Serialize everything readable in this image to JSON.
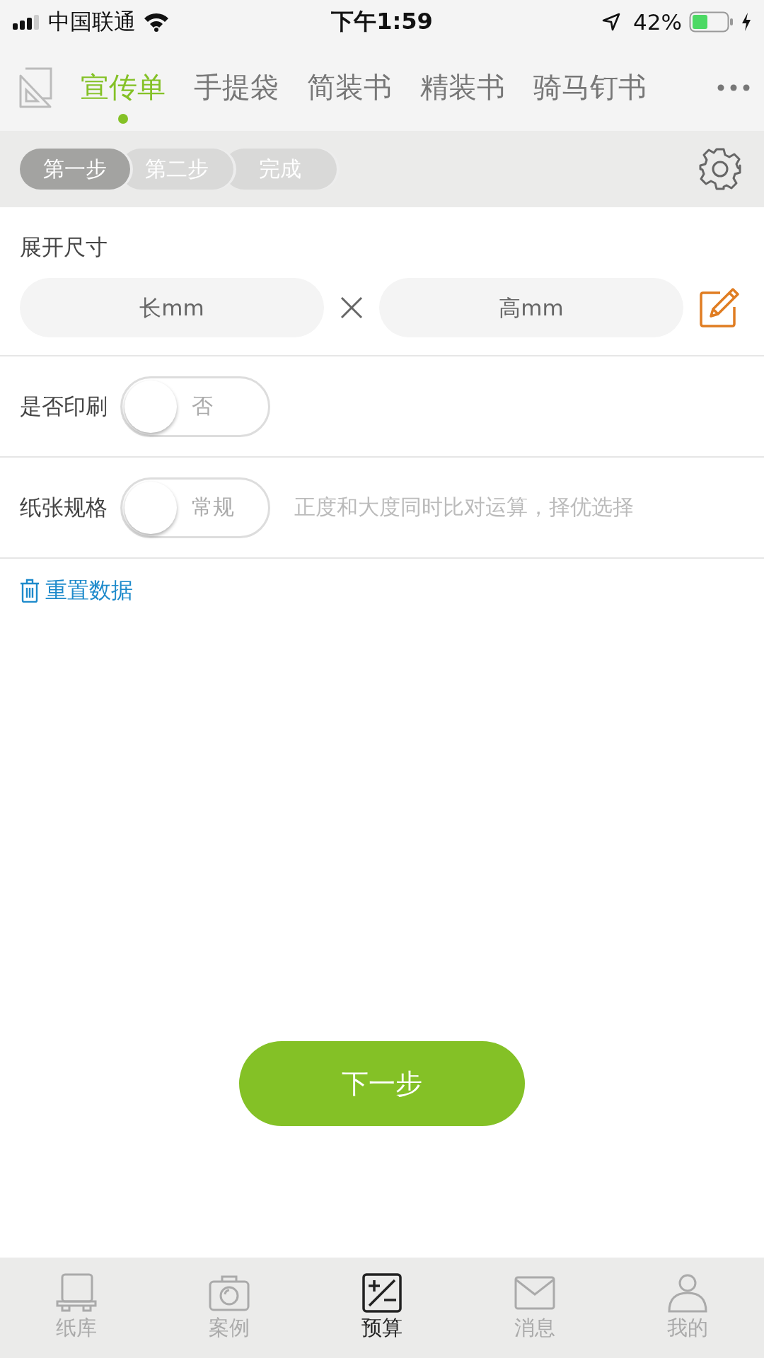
{
  "status_bar": {
    "carrier": "中国联通",
    "time": "下午1:59",
    "battery": "42%"
  },
  "category_tabs": [
    {
      "label": "宣传单",
      "selected": true
    },
    {
      "label": "手提袋",
      "selected": false
    },
    {
      "label": "简装书",
      "selected": false
    },
    {
      "label": "精装书",
      "selected": false
    },
    {
      "label": "骑马钉书",
      "selected": false
    }
  ],
  "steps": [
    {
      "label": "第一步",
      "selected": true
    },
    {
      "label": "第二步",
      "selected": false
    },
    {
      "label": "完成",
      "selected": false
    }
  ],
  "size": {
    "label": "展开尺寸",
    "length": {
      "placeholder": "长mm"
    },
    "height": {
      "placeholder": "高mm"
    }
  },
  "options": [
    {
      "label": "是否印刷",
      "toggle_text": "否",
      "on": false
    },
    {
      "label": "纸张规格",
      "toggle_text": "常规",
      "on": false,
      "hint": "正度和大度同时比对运算，择优选择"
    }
  ],
  "reset_link": "重置数据",
  "next_button": "下一步",
  "bottom_tabs": [
    {
      "label": "纸库",
      "selected": false
    },
    {
      "label": "案例",
      "selected": false
    },
    {
      "label": "预算",
      "selected": true
    },
    {
      "label": "消息",
      "selected": false
    },
    {
      "label": "我的",
      "selected": false
    }
  ]
}
